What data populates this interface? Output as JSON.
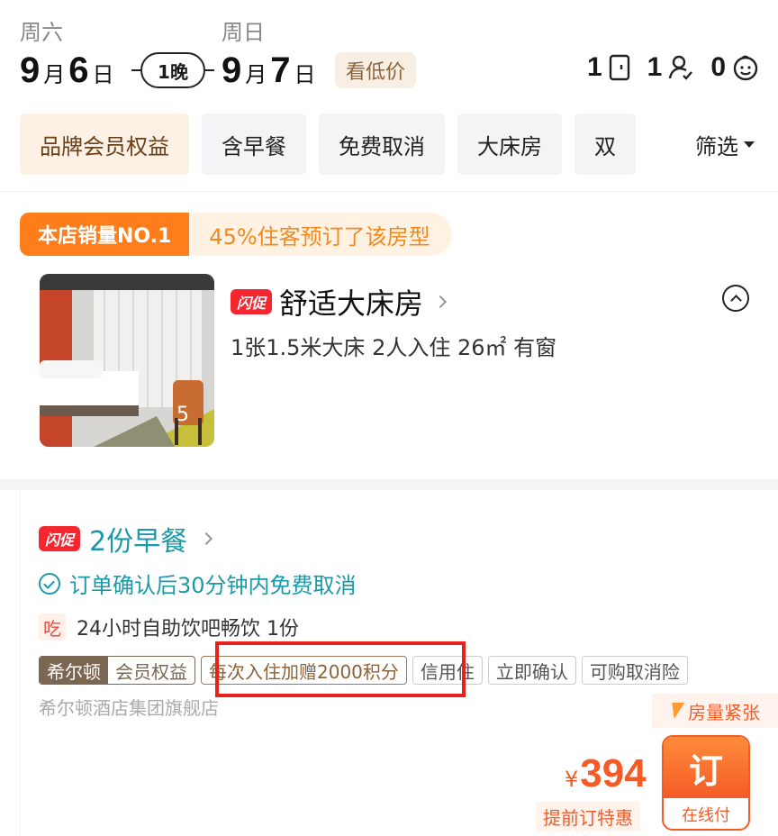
{
  "dates": {
    "checkin": {
      "weekday": "周六",
      "month": "9",
      "month_unit": "月",
      "day": "6",
      "day_unit": "日"
    },
    "checkout": {
      "weekday": "周日",
      "month": "9",
      "month_unit": "月",
      "day": "7",
      "day_unit": "日"
    },
    "nights": "1晚",
    "low_price_label": "看低价"
  },
  "guests": {
    "rooms": "1",
    "adults": "1",
    "children": "0"
  },
  "filters": {
    "chips": [
      "品牌会员权益",
      "含早餐",
      "免费取消",
      "大床房",
      "双"
    ],
    "filter_button": "筛选"
  },
  "room": {
    "badge_main": "本店销量NO.1",
    "badge_sub": "45%住客预订了该房型",
    "flash_tag": "闪促",
    "title": "舒适大床房",
    "specs": "1张1.5米大床  2人入住  26㎡  有窗",
    "photo_count": "5"
  },
  "rate_plan": {
    "flash_tag": "闪促",
    "title": "2份早餐",
    "cancel_policy": "订单确认后30分钟内免费取消",
    "meal_icon": "吃",
    "meal_text": "24小时自助饮吧畅饮  1份",
    "hilton_tag_left": "希尔顿",
    "hilton_tag_right": "会员权益",
    "points_tag": "每次入住加赠2000积分",
    "tags": [
      "信用住",
      "立即确认",
      "可购取消险"
    ],
    "store_name": "希尔顿酒店集团旗舰店",
    "scarcity": "房量紧张",
    "currency": "¥",
    "price": "394",
    "promo_label": "提前订特惠",
    "book_label": "订",
    "pay_label": "在线付"
  },
  "colors": {
    "accent_orange": "#ff7d1a",
    "price_red": "#f45b27",
    "teal": "#1a9aa8",
    "highlight_box": "#e5231b"
  }
}
